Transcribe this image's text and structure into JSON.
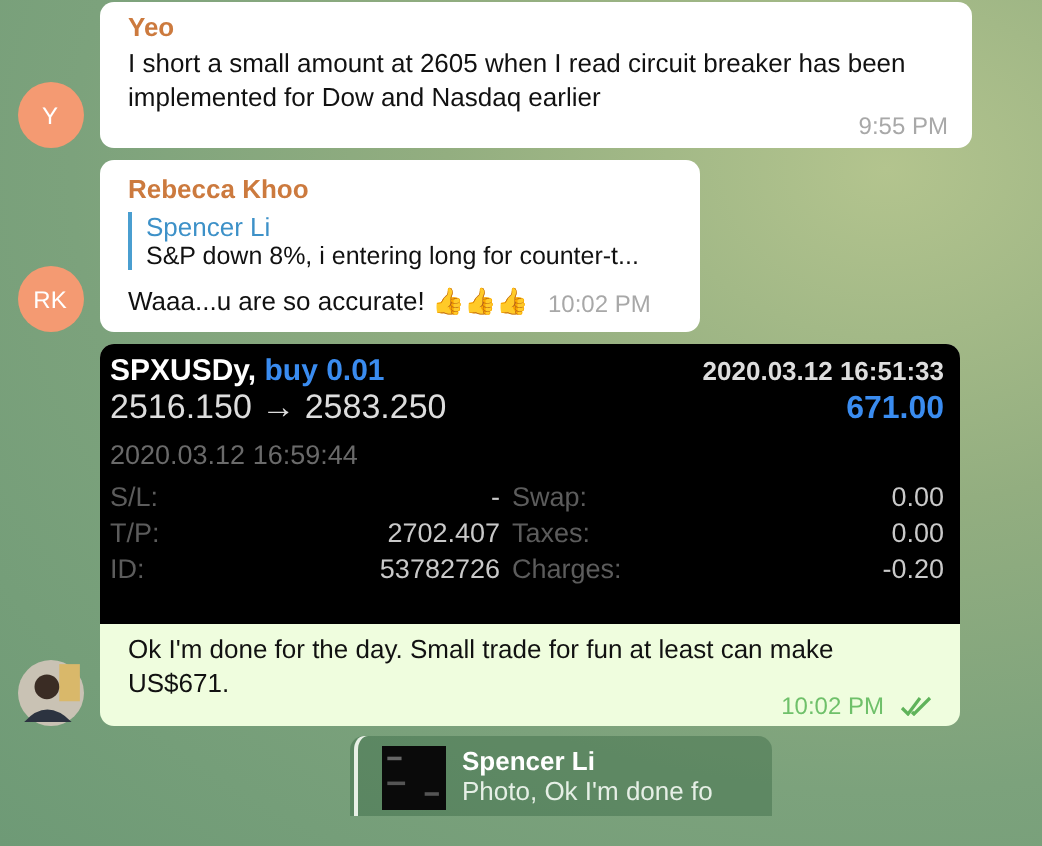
{
  "messages": [
    {
      "kind": "text",
      "author": "Yeo",
      "avatar": {
        "kind": "initials",
        "text": "Y"
      },
      "text": "I short a small amount at 2605 when I read circuit breaker has been implemented for Dow and Nasdaq earlier",
      "time": "9:55 PM",
      "outgoing": false
    },
    {
      "kind": "reply",
      "author": "Rebecca Khoo",
      "avatar": {
        "kind": "initials",
        "text": "RK"
      },
      "quote_author": "Spencer Li",
      "quote_text": "S&P down 8%, i entering long for counter-t...",
      "text": "Waaa...u are so accurate! 👍👍👍",
      "time": "10:02 PM",
      "outgoing": false
    },
    {
      "text": "Ok I'm done for the day. Small trade for fun at least can make US$671.",
      "time": "10:02 PM",
      "outgoing": true,
      "read": true,
      "trade": {
        "symbol": "SPXUSDy,",
        "action": "buy 0.01",
        "open_time": "2020.03.12 16:51:33",
        "prices": "2516.150 → 2583.250",
        "profit": "671.00",
        "close_time": "2020.03.12 16:59:44",
        "rows": [
          {
            "label": "S/L:",
            "value": "-",
            "label_2": "Swap:",
            "value_2": "0.00"
          },
          {
            "label": "T/P:",
            "value": "2702.407",
            "label_2": "Taxes:",
            "value_2": "0.00"
          },
          {
            "label": "ID:",
            "value": "53782726",
            "label_2": "Charges:",
            "value_2": "-0.20"
          }
        ]
      }
    },
    {
      "kind": "pinned",
      "author": "Spencer Li",
      "text": "Photo, Ok I'm done fo"
    }
  ]
}
